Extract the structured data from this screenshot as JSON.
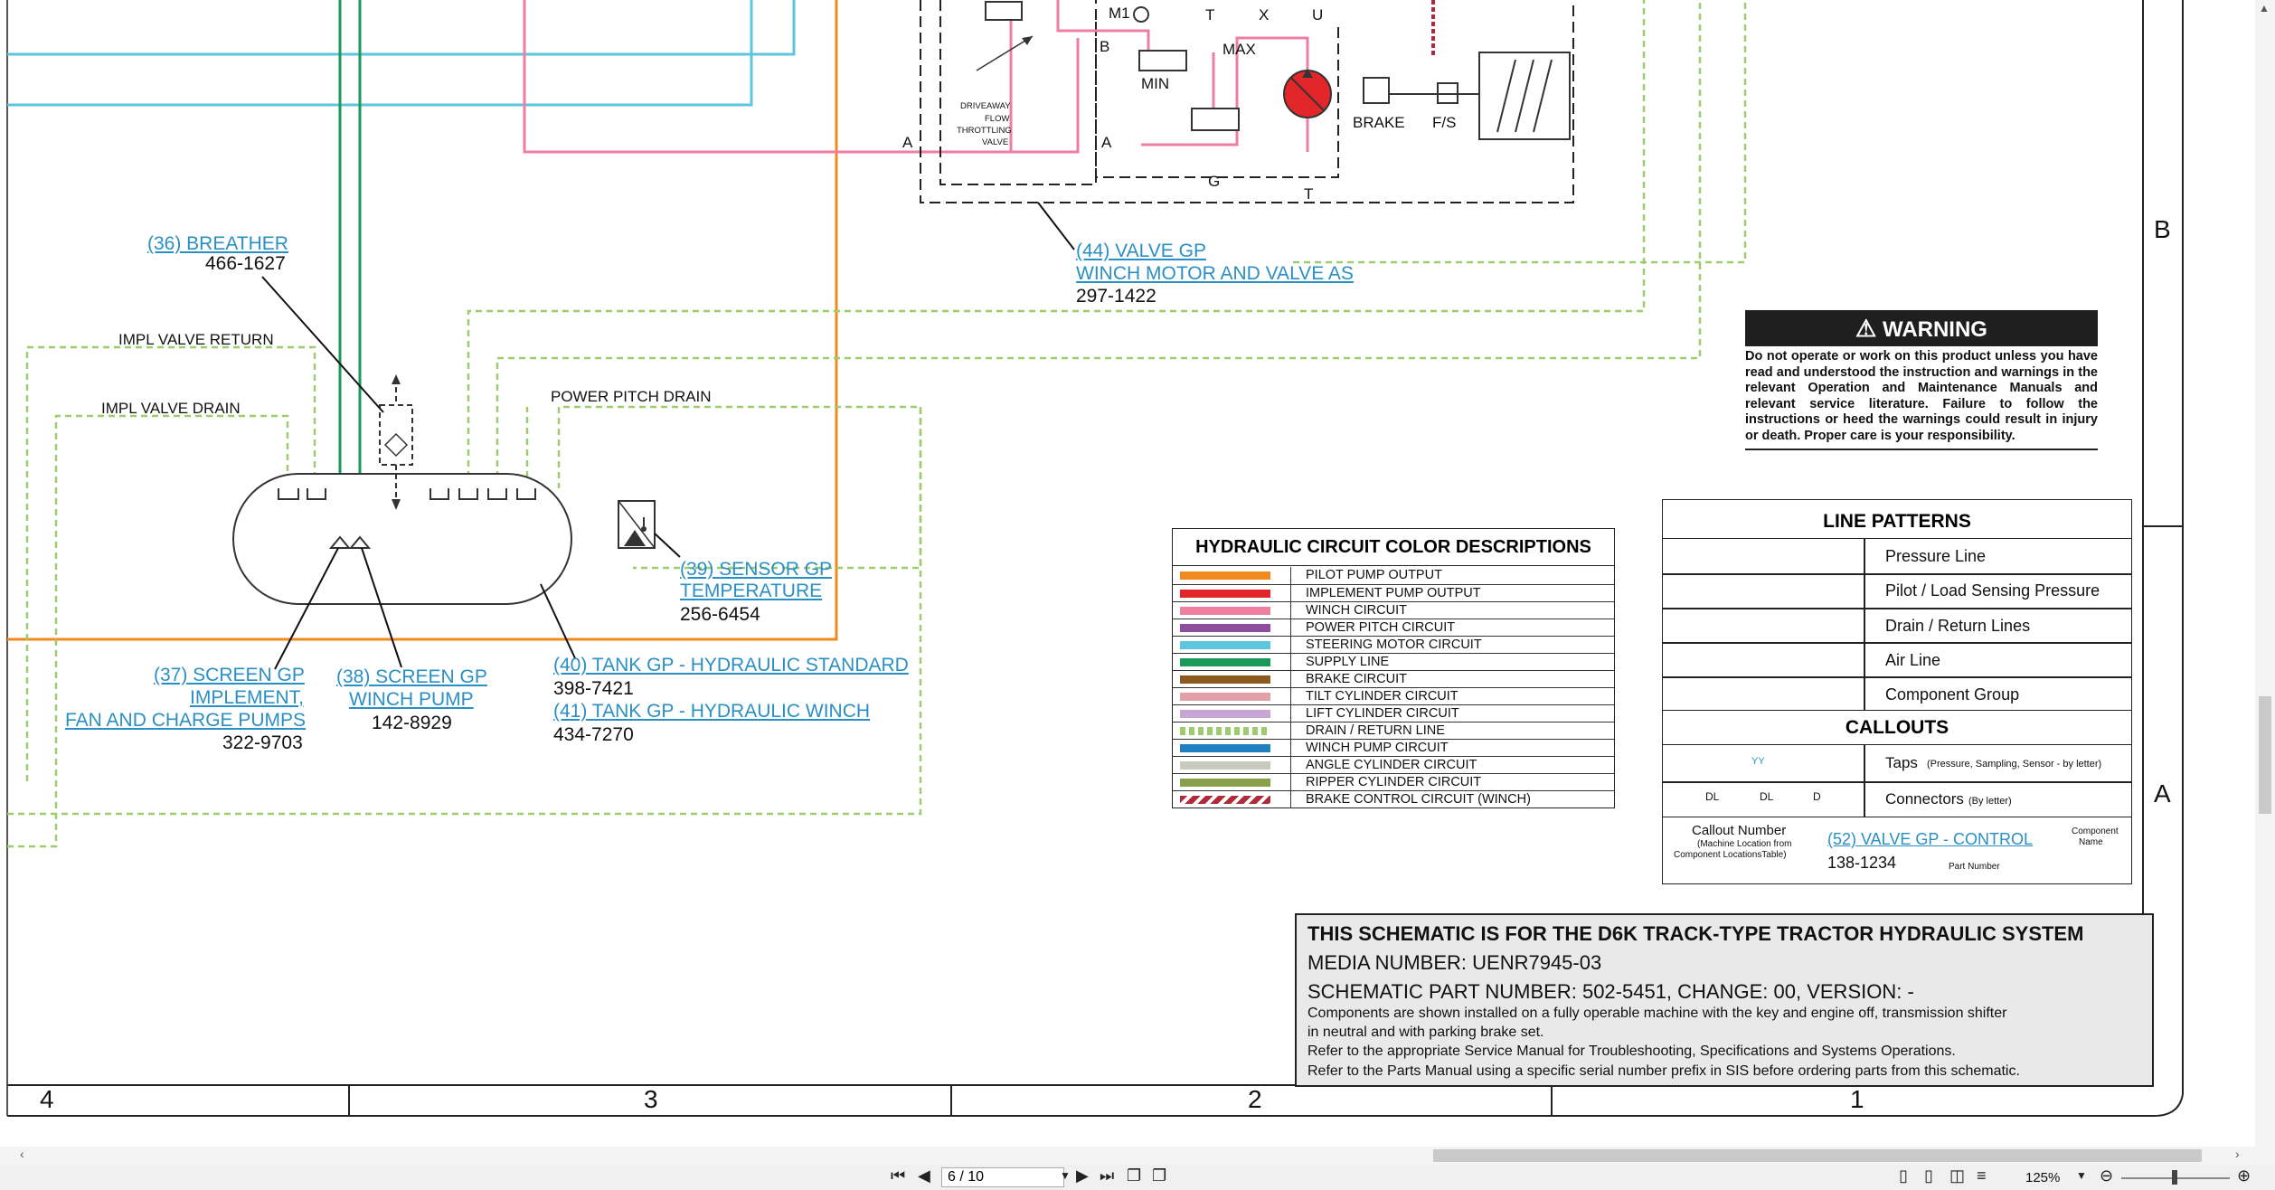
{
  "callouts": {
    "breather": {
      "name": "(36) BREATHER",
      "part": "466-1627"
    },
    "screen_implement": {
      "line1": "(37) SCREEN GP",
      "line2": "IMPLEMENT,",
      "line3": "FAN AND CHARGE PUMPS",
      "part": "322-9703"
    },
    "screen_winch": {
      "line1": "(38) SCREEN GP",
      "line2": "WINCH PUMP",
      "part": "142-8929"
    },
    "sensor_temp": {
      "line1": "(39) SENSOR GP",
      "line2": "TEMPERATURE",
      "part": "256-6454"
    },
    "tank_standard": {
      "name": "(40) TANK GP - HYDRAULIC STANDARD",
      "part": "398-7421"
    },
    "tank_winch": {
      "name": "(41) TANK GP - HYDRAULIC WINCH",
      "part": "434-7270"
    },
    "winch_valve": {
      "line1": "(44) VALVE GP",
      "line2": "WINCH MOTOR AND VALVE AS",
      "part": "297-1422"
    }
  },
  "line_labels": {
    "impl_valve_return": "IMPL VALVE RETURN",
    "impl_valve_drain": "IMPL VALVE DRAIN",
    "power_pitch_drain": "POWER PITCH DRAIN"
  },
  "valve_labels": {
    "m1": "M1",
    "t_top": "T",
    "x": "X",
    "u": "U",
    "b": "B",
    "max": "MAX",
    "min": "MIN",
    "a_left": "A",
    "a_right": "A",
    "g": "G",
    "t_bottom": "T",
    "brake": "BRAKE",
    "fs": "F/S",
    "driveaway_1": "DRIVEAWAY",
    "driveaway_2": "FLOW",
    "driveaway_3": "THROTTLING",
    "driveaway_4": "VALVE"
  },
  "warning": {
    "title": "WARNING",
    "body": "Do not operate or work on this product unless you have read and understood the instruction and warnings in the relevant Operation and Maintenance Manuals and relevant service literature. Failure to follow the instructions or heed the warnings could result in injury or death. Proper care is your responsibility."
  },
  "color_legend": {
    "title": "HYDRAULIC CIRCUIT COLOR DESCRIPTIONS",
    "items": [
      {
        "label": "PILOT PUMP OUTPUT",
        "color": "#f08a1c"
      },
      {
        "label": "IMPLEMENT PUMP OUTPUT",
        "color": "#e2262a"
      },
      {
        "label": "WINCH CIRCUIT",
        "color": "#ee7fa0"
      },
      {
        "label": "POWER PITCH CIRCUIT",
        "color": "#8e4d9e"
      },
      {
        "label": "STEERING MOTOR CIRCUIT",
        "color": "#5cc6de"
      },
      {
        "label": "SUPPLY LINE",
        "color": "#1a9a5a"
      },
      {
        "label": "BRAKE CIRCUIT",
        "color": "#8b5a1e"
      },
      {
        "label": "TILT CYLINDER CIRCUIT",
        "color": "#e3a0a6"
      },
      {
        "label": "LIFT CYLINDER CIRCUIT",
        "color": "#c7a6d6"
      },
      {
        "label": "DRAIN / RETURN LINE",
        "color": "#9ccc6e"
      },
      {
        "label": "WINCH PUMP CIRCUIT",
        "color": "#1f7fc0"
      },
      {
        "label": "ANGLE CYLINDER CIRCUIT",
        "color": "#c9c9bd"
      },
      {
        "label": "RIPPER CYLINDER CIRCUIT",
        "color": "#88a04a"
      },
      {
        "label": "BRAKE CONTROL CIRCUIT (WINCH)",
        "color": "#b02a3a"
      }
    ]
  },
  "line_patterns": {
    "title": "LINE PATTERNS",
    "items": [
      "Pressure Line",
      "Pilot / Load Sensing Pressure",
      "Drain / Return Lines",
      "Air Line",
      "Component Group"
    ],
    "callouts_title": "CALLOUTS",
    "taps_label": "Taps",
    "taps_note": "(Pressure, Sampling, Sensor - by letter)",
    "taps_symbol": "YY",
    "connectors_label": "Connectors",
    "connectors_note": "(By letter)",
    "conn_sym_1": "DL",
    "conn_sym_2": "DL",
    "conn_sym_3": "D",
    "example_callout_number": "Callout Number",
    "example_location_note_1": "(Machine Location from",
    "example_location_note_2": "Component LocationsTable)",
    "example_name": "(52) VALVE GP - CONTROL",
    "example_component_name_1": "Component",
    "example_component_name_2": "Name",
    "example_part": "138-1234",
    "example_part_number": "Part Number"
  },
  "title_block": {
    "line1": "THIS SCHEMATIC IS FOR THE D6K TRACK-TYPE TRACTOR HYDRAULIC SYSTEM",
    "line2": "MEDIA NUMBER: UENR7945-03",
    "line3": "SCHEMATIC PART NUMBER: 502-5451, CHANGE: 00, VERSION: -",
    "line4": "Components are shown installed on a fully operable machine with the key and engine off, transmission shifter",
    "line5": "in neutral and with parking brake set.",
    "line6": "Refer to the appropriate Service Manual for Troubleshooting, Specifications and Systems Operations.",
    "line7": "Refer to the Parts Manual using a specific serial number prefix in SIS before ordering parts from this schematic."
  },
  "zones": {
    "col4": "4",
    "col3": "3",
    "col2": "2",
    "col1": "1",
    "rowB": "B",
    "rowA": "A"
  },
  "viewer": {
    "page_value": "6 / 10",
    "zoom": "125%"
  }
}
